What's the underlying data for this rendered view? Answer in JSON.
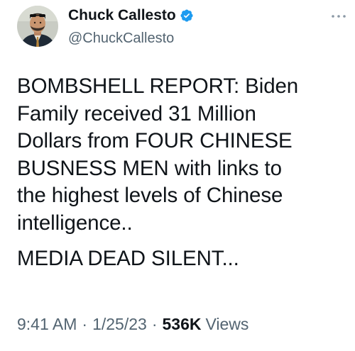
{
  "author": {
    "display_name": "Chuck Callesto",
    "handle": "@ChuckCallesto",
    "verified": true,
    "verified_color": "#1d9bf0"
  },
  "tweet": {
    "paragraphs": [
      "BOMBSHELL REPORT: Biden\nFamily received 31 Million\nDollars from FOUR CHINESE\nBUSNESS MEN with links to\nthe highest levels of Chinese\nintelligence..",
      "MEDIA DEAD SILENT..."
    ],
    "time": "9:41 AM",
    "separator": "·",
    "date": "1/25/23",
    "views_count": "536K",
    "views_label": "Views"
  },
  "icons": {
    "verified": "verified-badge-icon",
    "more": "more-options-icon"
  }
}
